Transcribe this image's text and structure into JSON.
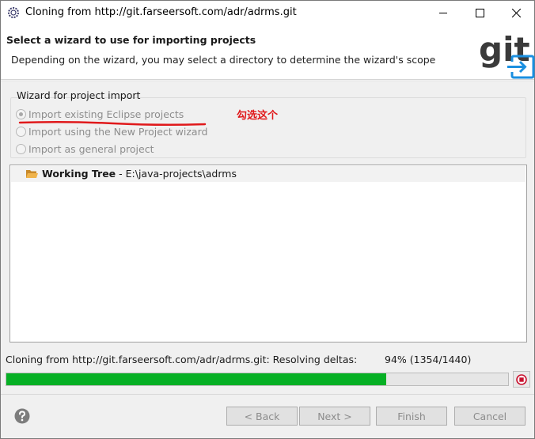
{
  "window": {
    "title": "Cloning from http://git.farseersoft.com/adr/adrms.git"
  },
  "header": {
    "title": "Select a wizard to use for importing projects",
    "description": "Depending on the wizard, you may select a directory to determine the wizard's scope",
    "logo_text": "git"
  },
  "wizard_group": {
    "label": "Wizard for project import",
    "options": [
      {
        "label": "Import existing Eclipse projects",
        "checked": true
      },
      {
        "label": "Import using the New Project wizard",
        "checked": false
      },
      {
        "label": "Import as general project",
        "checked": false
      }
    ],
    "annotation": "勾选这个"
  },
  "tree": {
    "item_name": "Working Tree",
    "item_path": " - E:\\java-projects\\adrms"
  },
  "progress": {
    "text": "Cloning from http://git.farseersoft.com/adr/adrms.git: Resolving deltas:",
    "percent_text": "94% (1354/1440)",
    "percent": 94
  },
  "buttons": {
    "back": "< Back",
    "next": "Next >",
    "finish": "Finish",
    "cancel": "Cancel"
  },
  "colors": {
    "progress_fill": "#06b025",
    "annotation": "#e0191b",
    "git_logo": "#3a3a3a",
    "import_icon": "#1a8fe0"
  }
}
